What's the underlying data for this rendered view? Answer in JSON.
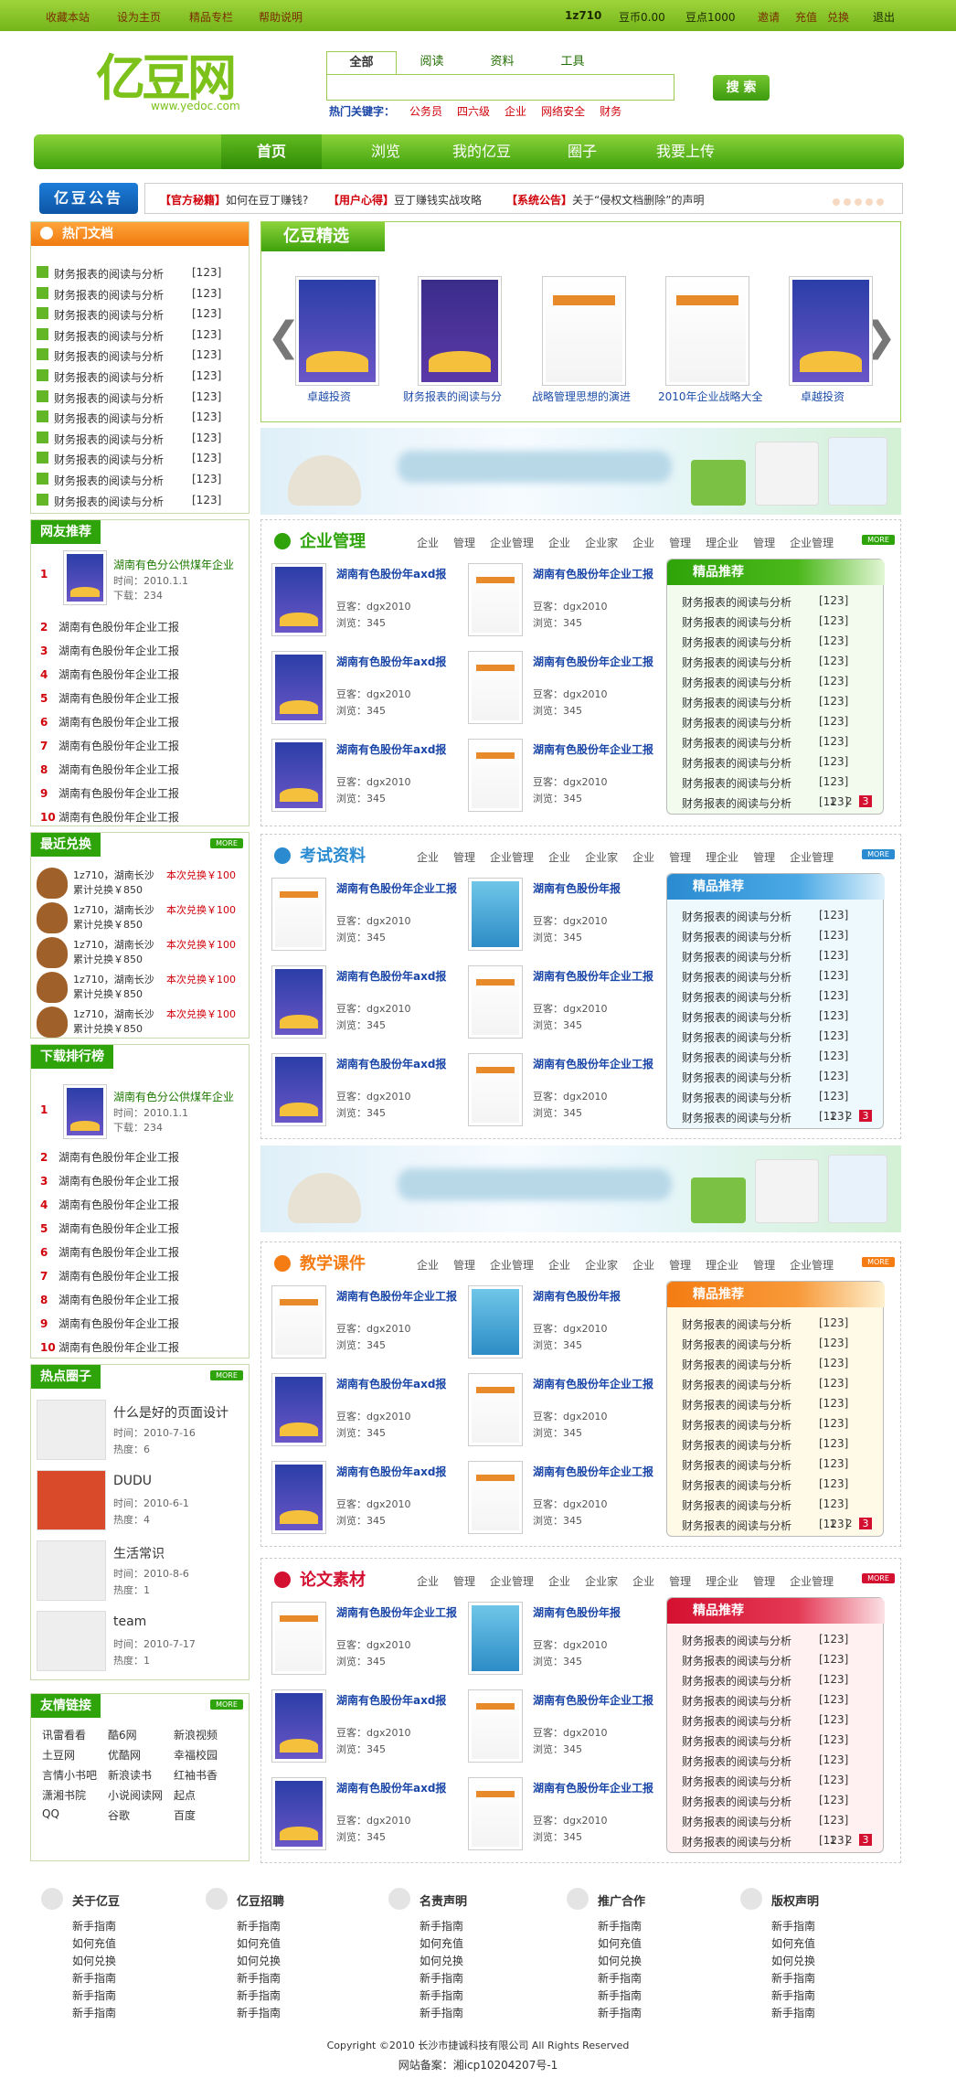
{
  "top": {
    "l1": "收藏本站",
    "l2": "设为主页",
    "l3": "精品专栏",
    "l4": "帮助说明",
    "user": "1z710",
    "coins": "豆币0.00",
    "points": "豆点1000",
    "invite": "邀请",
    "charge": "充值",
    "exch": "兑换",
    "logout": "退出"
  },
  "logo": {
    "text": "亿豆网",
    "url": "www.yedoc.com"
  },
  "search": {
    "tabs": [
      "全部",
      "阅读",
      "资料",
      "工具"
    ],
    "button": "搜 索",
    "hot_label": "热门关键字：",
    "hot": [
      "公务员",
      "四六级",
      "企业",
      "网络安全",
      "财务"
    ]
  },
  "nav": [
    "首页",
    "浏览",
    "我的亿豆",
    "圈子",
    "我要上传"
  ],
  "ann": {
    "badge": "亿豆公告",
    "i1t": "【官方秘籍】",
    "i1": "如何在豆丁赚钱?",
    "i2t": "【用户心得】",
    "i2": "豆丁赚钱实战攻略",
    "i3t": "【系统公告】",
    "i3": "关于“侵权文档删除”的声明"
  },
  "hotdocs": {
    "title": "热门文档",
    "text": "财务报表的阅读与分析",
    "count": "[123]"
  },
  "netrec": {
    "title": "网友推荐",
    "top": "湖南有色分公供煤年企业",
    "time": "时间：2010.1.1",
    "dl": "下载：234",
    "items": [
      "湖南有色股份年企业工报",
      "湖南有色股份年企业工报",
      "湖南有色股份年企业工报",
      "湖南有色股份年企业工报",
      "湖南有色股份年企业工报",
      "湖南有色股份年企业工报",
      "湖南有色股份年企业工报",
      "湖南有色股份年企业工报",
      "湖南有色股份年企业工报"
    ]
  },
  "exch": {
    "title": "最近兑换",
    "l1": "1z710，湖南长沙",
    "l2": "累计兑换￥850",
    "now": "本次兑换￥100"
  },
  "dlrank": {
    "title": "下载排行榜"
  },
  "circle": {
    "title": "热点圈子",
    "items": [
      {
        "n": "什么是好的页面设计",
        "t": "时间：2010-7-16",
        "h": "热度：6"
      },
      {
        "n": "DUDU",
        "t": "时间：2010-6-1",
        "h": "热度：4"
      },
      {
        "n": "生活常识",
        "t": "时间：2010-8-6",
        "h": "热度：1"
      },
      {
        "n": "team",
        "t": "时间：2010-7-17",
        "h": "热度：1"
      }
    ]
  },
  "links": {
    "title": "友情链接",
    "items": [
      "讯雷看看",
      "酷6网",
      "新浪视频",
      "土豆网",
      "优酷网",
      "幸福校园",
      "言情小书吧",
      "新浪读书",
      "红袖书香",
      "潇湘书院",
      "小说阅读网",
      "起点",
      "QQ",
      "谷歌",
      "百度"
    ]
  },
  "jx": {
    "title": "亿豆精选",
    "caps": [
      "卓越投资",
      "财务报表的阅读与分",
      "战略管理思想的演进",
      "2010年企业战略大全",
      "卓越投资"
    ]
  },
  "sections": [
    {
      "title": "企业管理"
    },
    {
      "title": "考试资料"
    },
    {
      "title": "教学课件"
    },
    {
      "title": "论文素材"
    }
  ],
  "tags": [
    "企业",
    "管理",
    "企业管理",
    "企业",
    "企业家",
    "企业",
    "管理",
    "理企业",
    "管理",
    "企业管理"
  ],
  "item": {
    "t1": "湖南有色股份年axd报",
    "t2": "湖南有色股份年企业工报",
    "t3": "湖南有色股份年报",
    "up": "豆客：dgx2010",
    "views": "浏览：345"
  },
  "rec": {
    "title": "精品推荐",
    "text": "财务报表的阅读与分析",
    "count": "[123]",
    "pages": [
      "1",
      "2",
      "3"
    ]
  },
  "more": "MORE",
  "footer": {
    "cols": [
      "关于亿豆",
      "亿豆招聘",
      "名责声明",
      "推广合作",
      "版权声明"
    ],
    "cols2": [
      [
        "新手指南",
        "如何充值",
        "如何兑换",
        "新手指南",
        "新手指南",
        "新手指南"
      ]
    ],
    "copy": "Copyright ©2010 长沙市捷诚科技有限公司 All Rights Reserved",
    "icp": "网站备案：湘icp10204207号-1"
  },
  "colors": {
    "green": "#5cb41c",
    "orange": "#f47c13",
    "blue": "#2b8bd1",
    "red": "#d41030"
  }
}
